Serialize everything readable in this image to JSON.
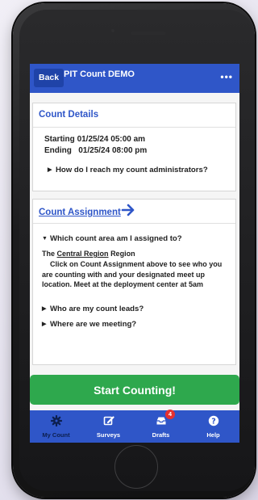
{
  "header": {
    "back_label": "Back",
    "title": "PIT Count DEMO",
    "more": "•••"
  },
  "count_details": {
    "title": "Count Details",
    "starting_label": "Starting",
    "starting_value": "01/25/24 05:00 am",
    "ending_label": "Ending",
    "ending_value": "01/25/24 08:00 pm",
    "faq": "How do I reach my count administrators?"
  },
  "count_assignment": {
    "title": "Count Assignment",
    "expanded_question": "Which count area am I assigned to?",
    "region_prefix": "The",
    "region_name": "Central Region",
    "region_suffix": "Region",
    "instructions": "Click on Count Assignment above to see who you are counting with and your designated meet up location. Meet at the deployment center at 5am",
    "faq_leads": "Who are my count leads?",
    "faq_meeting": "Where are we meeting?"
  },
  "start_button": "Start Counting!",
  "tabs": [
    {
      "label": "My Count",
      "icon": "gear-icon"
    },
    {
      "label": "Surveys",
      "icon": "edit-icon"
    },
    {
      "label": "Drafts",
      "icon": "inbox-icon",
      "badge": "4"
    },
    {
      "label": "Help",
      "icon": "question-icon"
    }
  ],
  "colors": {
    "primary": "#2f56c8",
    "success": "#2ea84d",
    "badge": "#e63030"
  }
}
